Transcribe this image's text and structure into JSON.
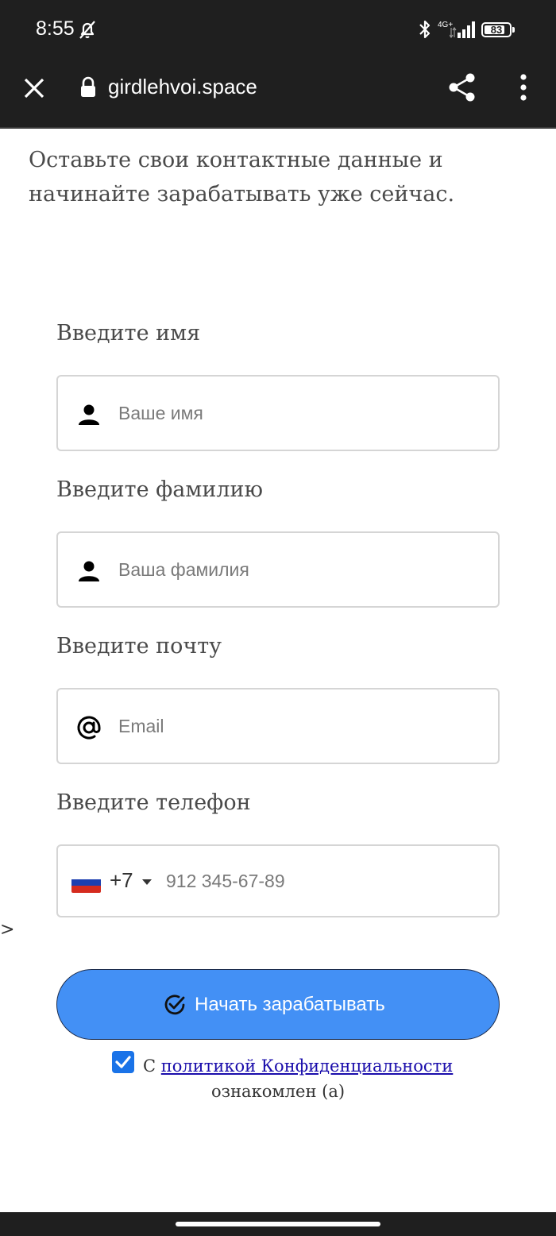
{
  "status_bar": {
    "time": "8:55",
    "network": "4G+",
    "battery": "83",
    "battery_level": 0.83
  },
  "browser": {
    "url": "girdlehvoi.space"
  },
  "intro_text": "Оставьте свои контактные данные и начинайте зарабатывать уже сейчас.",
  "form": {
    "first_name": {
      "label": "Введите имя",
      "placeholder": "Ваше имя",
      "value": ""
    },
    "last_name": {
      "label": "Введите фамилию",
      "placeholder": "Ваша фамилия",
      "value": ""
    },
    "email": {
      "label": "Введите почту",
      "placeholder": "Email",
      "value": ""
    },
    "phone": {
      "label": "Введите телефон",
      "country_code": "+7",
      "placeholder": "912 345-67-89",
      "value": ""
    },
    "stray_text": ">",
    "submit_label": "Начать зарабатывать",
    "consent": {
      "checked": true,
      "prefix": "С",
      "link_text": "политикой Конфиденциальности",
      "suffix": "ознакомлен (а)"
    }
  },
  "colors": {
    "button_bg": "#4390f5",
    "checkbox": "#1a73e8",
    "link": "#1a0dab",
    "chrome_bg": "#1f1f1f"
  }
}
